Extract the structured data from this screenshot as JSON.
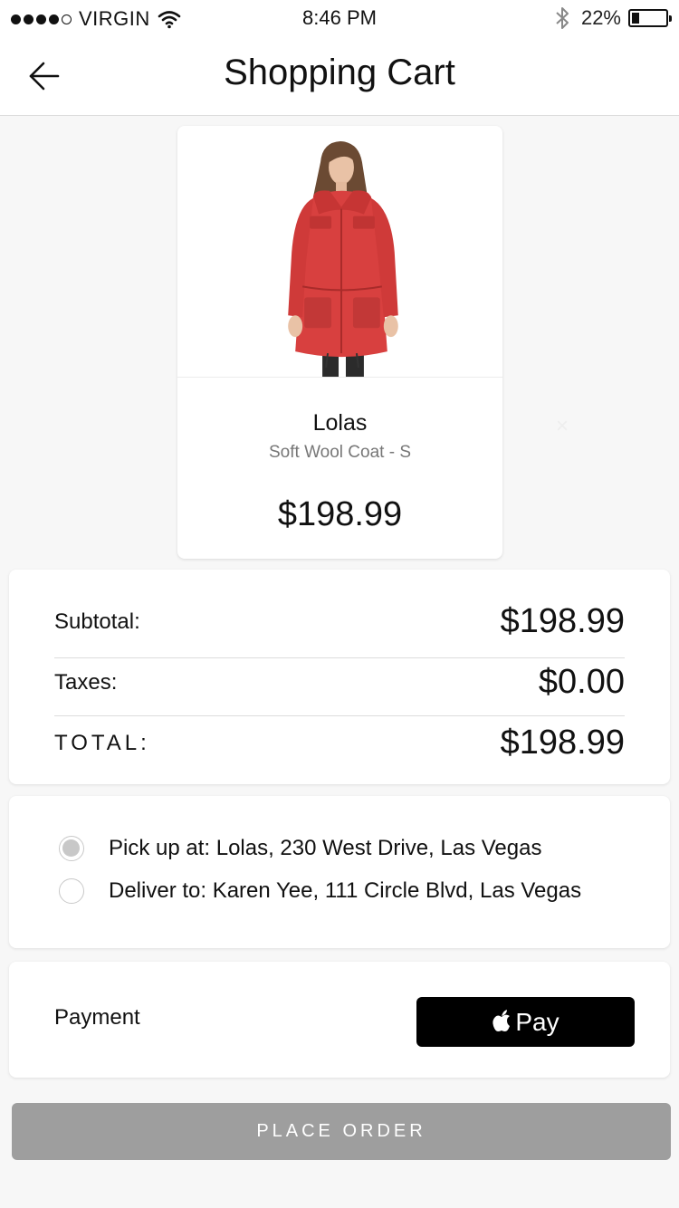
{
  "status_bar": {
    "carrier": "VIRGIN",
    "time": "8:46 PM",
    "battery_percent": "22%",
    "battery_level": 0.22,
    "signal_bars_filled": 4,
    "signal_bars_total": 5
  },
  "header": {
    "title": "Shopping Cart",
    "back_icon": "arrow-left-icon"
  },
  "cart_item": {
    "name": "Lolas",
    "variant": "Soft Wool Coat - S",
    "price": "$198.99",
    "remove_icon": "close-icon",
    "image": "red-coat-product-image"
  },
  "summary": {
    "subtotal_label": "Subtotal:",
    "subtotal_value": "$198.99",
    "taxes_label": "Taxes:",
    "taxes_value": "$0.00",
    "total_label": "TOTAL:",
    "total_value": "$198.99"
  },
  "delivery_options": [
    {
      "label": "Pick up at: Lolas, 230 West Drive, Las Vegas",
      "selected": true
    },
    {
      "label": "Deliver to: Karen Yee, 111 Circle Blvd, Las Vegas",
      "selected": false
    }
  ],
  "payment": {
    "label": "Payment",
    "method_text": "Pay",
    "method_icon": "apple-logo-icon"
  },
  "place_order": {
    "label": "PLACE ORDER"
  },
  "colors": {
    "coat_red": "#d8403f",
    "place_order_bg": "#9e9e9e",
    "apple_pay_bg": "#000000",
    "page_bg": "#f7f7f7"
  }
}
